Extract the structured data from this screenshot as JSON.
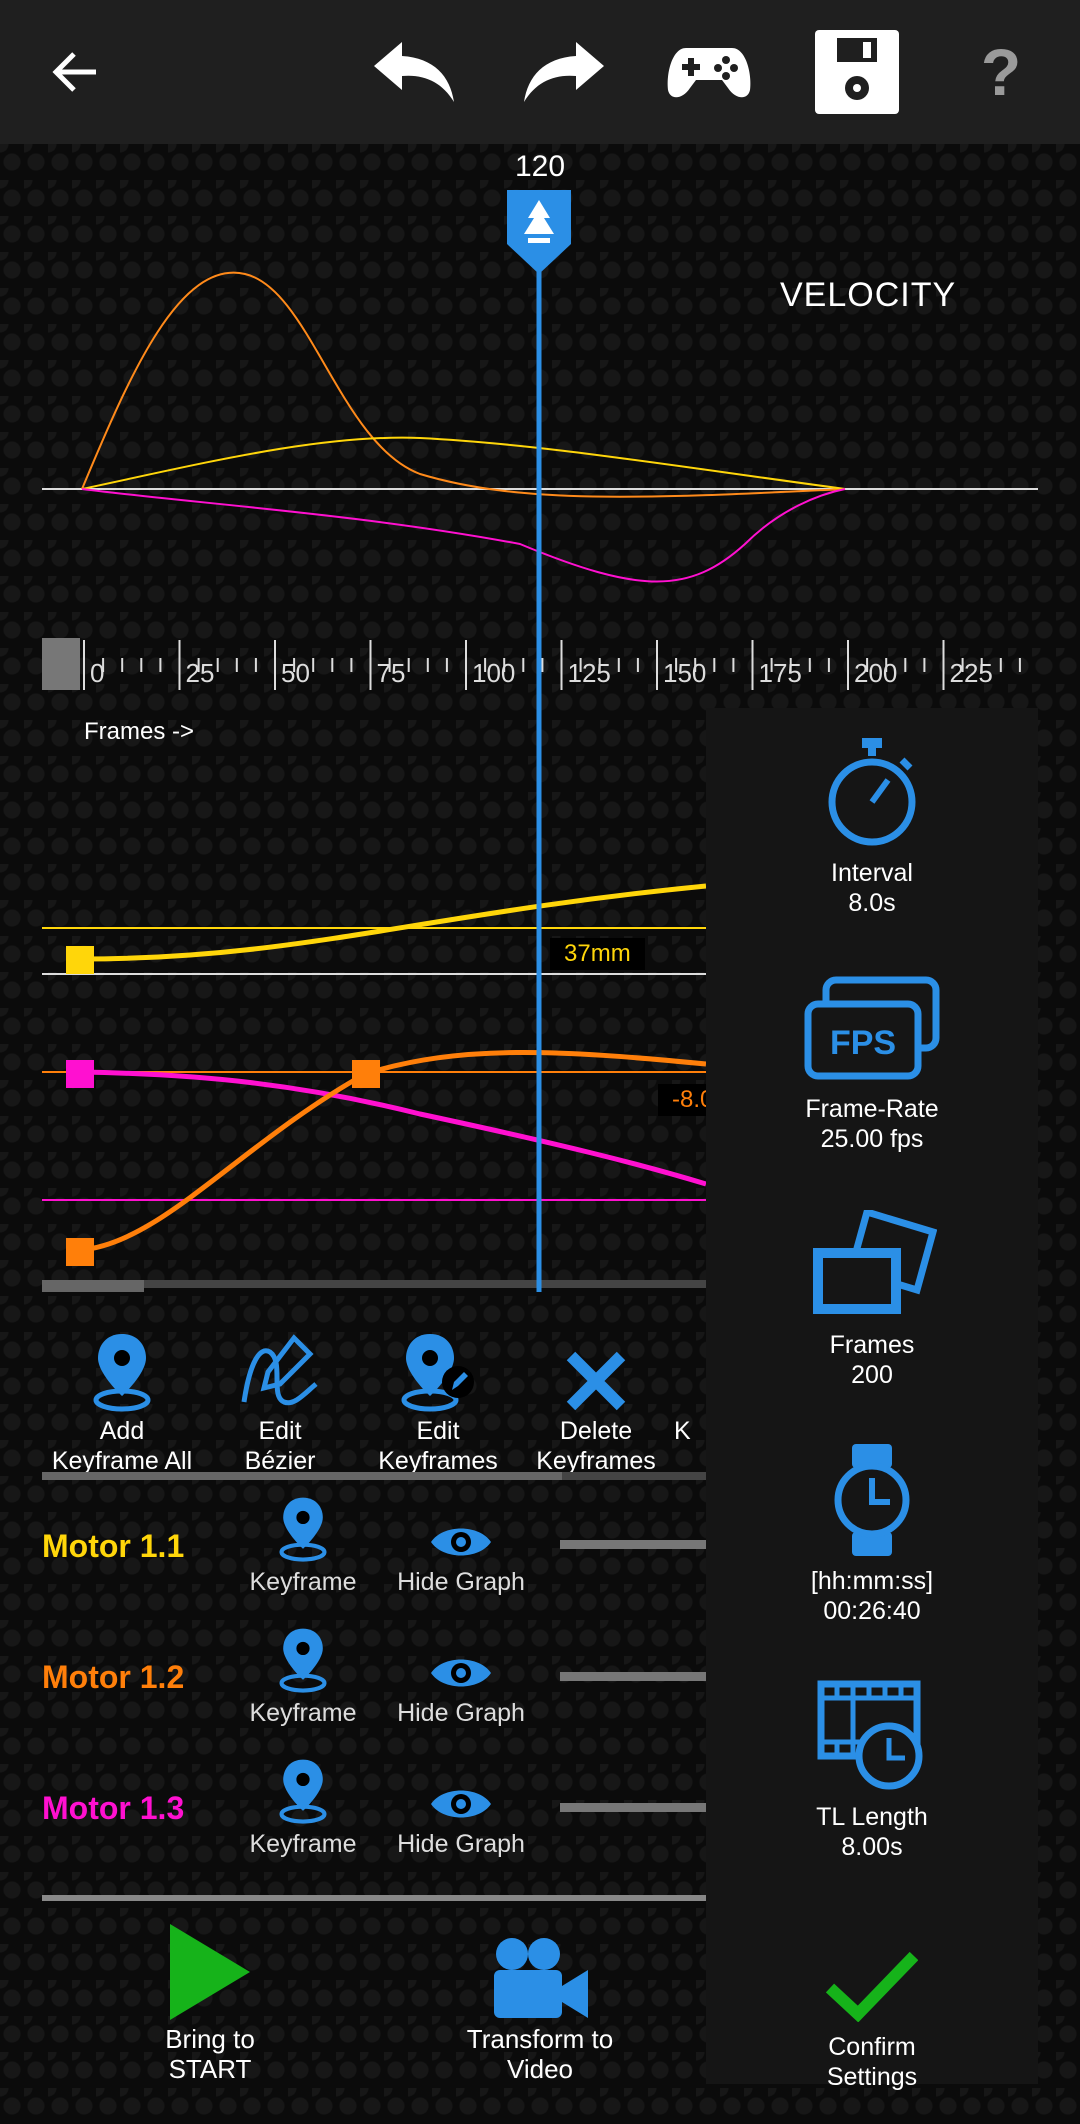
{
  "toolbar": {
    "back_icon": "arrow-left-icon",
    "undo_icon": "undo-icon",
    "redo_icon": "redo-icon",
    "gamepad_icon": "gamepad-icon",
    "save_icon": "floppy-save-icon",
    "help_label": "?"
  },
  "graph": {
    "mode_label": "VELOCITY",
    "playhead_frame": "120",
    "frames_axis_label": "Frames ->",
    "ticks": [
      "0",
      "25",
      "50",
      "75",
      "100",
      "125",
      "150",
      "175",
      "200",
      "225"
    ],
    "value_tag_yellow": "37mm",
    "value_tag_orange": "-8.0",
    "colors": {
      "motor1": "#ffd60a",
      "motor2": "#ff7f0a",
      "motor3": "#ff10d0",
      "accent": "#2b8fe6"
    }
  },
  "actions": [
    {
      "label1": "Add",
      "label2": "Keyframe All"
    },
    {
      "label1": "Edit",
      "label2": "Bézier"
    },
    {
      "label1": "Edit",
      "label2": "Keyframes"
    },
    {
      "label1": "Delete",
      "label2": "Keyframes"
    },
    {
      "label1": "",
      "label2": "K"
    }
  ],
  "motors": [
    {
      "name": "Motor 1.1",
      "color": "#ffd60a",
      "keyframe_label": "Keyframe",
      "hide_label": "Hide Graph"
    },
    {
      "name": "Motor 1.2",
      "color": "#ff7f0a",
      "keyframe_label": "Keyframe",
      "hide_label": "Hide Graph"
    },
    {
      "name": "Motor 1.3",
      "color": "#ff10d0",
      "keyframe_label": "Keyframe",
      "hide_label": "Hide Graph"
    }
  ],
  "bottom": {
    "start_label1": "Bring to",
    "start_label2": "START",
    "transform_label1": "Transform to",
    "transform_label2": "Video"
  },
  "settings": {
    "interval_label": "Interval",
    "interval_value": "8.0s",
    "framerate_label": "Frame-Rate",
    "framerate_value": "25.00 fps",
    "fps_badge": "FPS",
    "frames_label": "Frames",
    "frames_value": "200",
    "duration_label": "[hh:mm:ss]",
    "duration_value": "00:26:40",
    "tl_label": "TL Length",
    "tl_value": "8.00s",
    "confirm_label1": "Confirm",
    "confirm_label2": "Settings"
  }
}
